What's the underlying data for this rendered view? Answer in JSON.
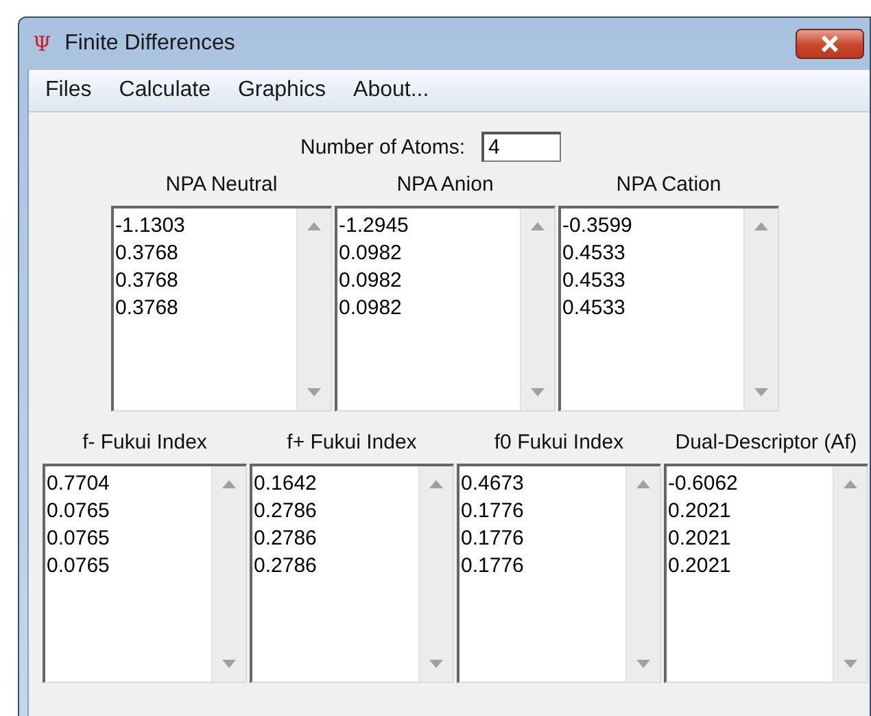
{
  "window": {
    "title": "Finite Differences",
    "icon": "Ψ"
  },
  "menu": [
    "Files",
    "Calculate",
    "Graphics",
    "About..."
  ],
  "atoms": {
    "label": "Number of Atoms:",
    "value": "4"
  },
  "npa_lists": [
    {
      "label": "NPA Neutral",
      "values": [
        "-1.1303",
        "0.3768",
        "0.3768",
        "0.3768"
      ]
    },
    {
      "label": "NPA Anion",
      "values": [
        "-1.2945",
        "0.0982",
        "0.0982",
        "0.0982"
      ]
    },
    {
      "label": "NPA Cation",
      "values": [
        "-0.3599",
        "0.4533",
        "0.4533",
        "0.4533"
      ]
    }
  ],
  "fukui_lists": [
    {
      "label": "f- Fukui Index",
      "values": [
        "0.7704",
        "0.0765",
        "0.0765",
        "0.0765"
      ]
    },
    {
      "label": "f+ Fukui Index",
      "values": [
        "0.1642",
        "0.2786",
        "0.2786",
        "0.2786"
      ]
    },
    {
      "label": "f0 Fukui Index",
      "values": [
        "0.4673",
        "0.1776",
        "0.1776",
        "0.1776"
      ]
    },
    {
      "label": "Dual-Descriptor (Af)",
      "values": [
        "-0.6062",
        "0.2021",
        "0.2021",
        "0.2021"
      ]
    }
  ]
}
